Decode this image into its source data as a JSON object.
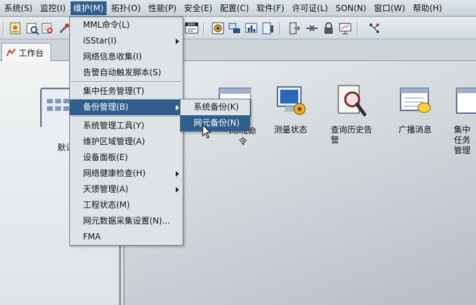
{
  "menubar": {
    "items": [
      {
        "label": "系统(S)"
      },
      {
        "label": "监控(I)"
      },
      {
        "label": "维护(M)"
      },
      {
        "label": "拓扑(O)"
      },
      {
        "label": "性能(P)"
      },
      {
        "label": "安全(E)"
      },
      {
        "label": "配置(C)"
      },
      {
        "label": "软件(F)"
      },
      {
        "label": "许可证(L)"
      },
      {
        "label": "SON(N)"
      },
      {
        "label": "窗口(W)"
      },
      {
        "label": "帮助(H)"
      }
    ],
    "active_index": 2
  },
  "toolbar": {
    "mml_badge": "MML"
  },
  "tab": {
    "label": "工作台"
  },
  "desktop": {
    "items": [
      {
        "label": "默认"
      },
      {
        "label": "MML命令"
      },
      {
        "label": "测量状态"
      },
      {
        "label": "查询历史告警"
      },
      {
        "label": "广播消息"
      },
      {
        "label": "集中任务管理"
      }
    ]
  },
  "maintenance_menu": {
    "items": [
      {
        "label": "MML命令(L)"
      },
      {
        "label": "iSStar(I)",
        "submenu": true
      },
      {
        "label": "网络信息收集(I)"
      },
      {
        "label": "告警自动触发脚本(S)"
      },
      {
        "label": "集中任务管理(T)"
      },
      {
        "label": "备份管理(B)",
        "submenu": true
      },
      {
        "label": "系统管理工具(Y)"
      },
      {
        "label": "维护区域管理(A)"
      },
      {
        "label": "设备面板(E)"
      },
      {
        "label": "网络健康检查(H)",
        "submenu": true
      },
      {
        "label": "天馈管理(A)",
        "submenu": true
      },
      {
        "label": "工程状态(M)"
      },
      {
        "label": "网元数据采集设置(N)..."
      },
      {
        "label": "FMA"
      }
    ]
  },
  "backup_submenu": {
    "items": [
      {
        "label": "系统备份(K)"
      },
      {
        "label": "网元备份(N)"
      }
    ]
  },
  "colors": {
    "highlight": "#2f5d8c",
    "menu_bg": "#dde3e6"
  }
}
